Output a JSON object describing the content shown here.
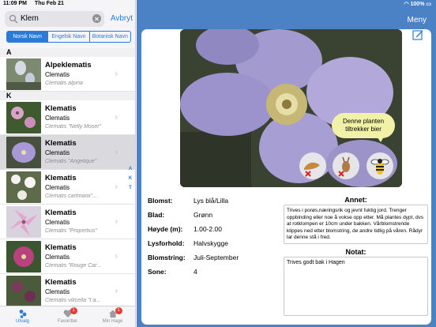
{
  "status": {
    "time": "11:09 PM",
    "date": "Thu Feb 21",
    "battery": "100%"
  },
  "search": {
    "value": "Klem",
    "cancel": "Avbryt"
  },
  "segments": [
    "Norsk Navn",
    "Engelsk Navn",
    "Botanisk Navn"
  ],
  "sections": [
    {
      "header": "A",
      "rows": [
        {
          "title": "Alpeklematis",
          "subtitle": "Clematis",
          "latin": "Clematis alpina"
        }
      ]
    },
    {
      "header": "K",
      "rows": [
        {
          "title": "Klematis",
          "subtitle": "Clematis",
          "latin": "Clematis \"Nelly Moser\""
        },
        {
          "title": "Klematis",
          "subtitle": "Clematis",
          "latin": "Clematis \"Angelique\""
        },
        {
          "title": "Klematis",
          "subtitle": "Clematis",
          "latin": "Clematis cartmanii\"..."
        },
        {
          "title": "Klematis",
          "subtitle": "Clematis",
          "latin": "Clematis \"Propertius\""
        },
        {
          "title": "Klematis",
          "subtitle": "Clematis",
          "latin": "Clematis \"Rouge Car..."
        },
        {
          "title": "Klematis",
          "subtitle": "Clematis",
          "latin": "Clematis viticella \"I a..."
        }
      ]
    }
  ],
  "index_letters": [
    "A",
    "K",
    "T"
  ],
  "tabs": [
    {
      "label": "Utvalg",
      "icon": "filter-icon",
      "badge": ""
    },
    {
      "label": "Favoritter",
      "icon": "heart-icon",
      "badge": "1"
    },
    {
      "label": "Min Hage",
      "icon": "house-icon",
      "badge": "1"
    }
  ],
  "menu": "Meny",
  "bubble": "Denne planten tiltrekker bier",
  "details": [
    {
      "label": "Blomst:",
      "value": "Lys blå/Lilla"
    },
    {
      "label": "Blad:",
      "value": "Grønn"
    },
    {
      "label": "Høyde (m):",
      "value": "1.00-2.00"
    },
    {
      "label": "Lysforhold:",
      "value": "Halvskygge"
    },
    {
      "label": "Blomstring:",
      "value": "Juli-September"
    },
    {
      "label": "Sone:",
      "value": "4"
    }
  ],
  "annet_title": "Annet:",
  "annet_text": "Trives i porøs,næringsrik og jevnt fuktig jord. Trenger oppbinding eller noe å vokse opp etter. Må plantes dypt, dvs at rotklompen er 10cm under bakken. Vårblomstrende klippes ned etter blomstring, de andre tidlig på våren. Rådyr lar denne stå i fred.",
  "notat_title": "Notat:",
  "notat_text": "Trives godt bak i Hagen",
  "colors": {
    "accent": "#2a7bd8",
    "header_bg": "#4a82c5",
    "bubble": "#f1f2a8",
    "badge": "#e53b30"
  }
}
